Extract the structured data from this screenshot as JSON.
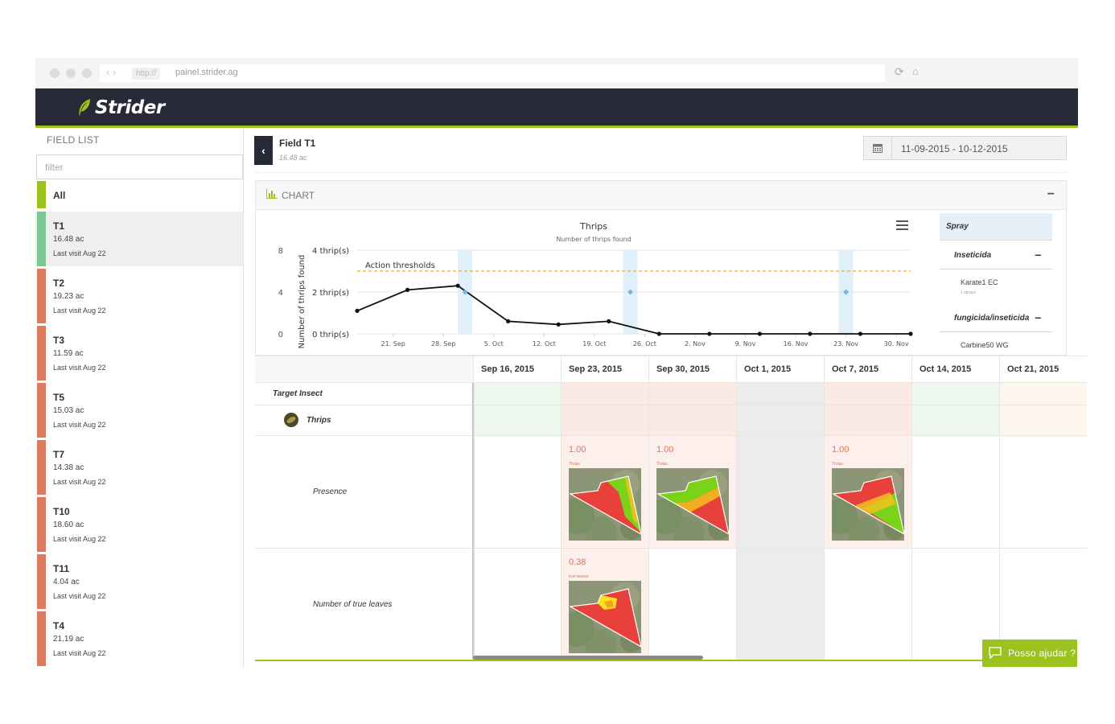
{
  "browser": {
    "protocol": "http://",
    "url": "painel.strider.ag",
    "nav_arrows": "‹ ›",
    "reload_icon": "reload-icon",
    "home_icon": "home-icon"
  },
  "app": {
    "name": "Strider",
    "logo_icon": "leaf-icon",
    "brand_color": "#9bc31f",
    "header_color": "#272a36"
  },
  "sidebar": {
    "title": "FIELD LIST",
    "filter_placeholder": "filter",
    "all_label": "All",
    "fields": [
      {
        "name": "T1",
        "acres": "16.48 ac",
        "last_visit": "Last visit Aug 22",
        "color": "#7dc698",
        "selected": true
      },
      {
        "name": "T2",
        "acres": "19.23 ac",
        "last_visit": "Last visit Aug 22",
        "color": "#de7a5e"
      },
      {
        "name": "T3",
        "acres": "11.59 ac",
        "last_visit": "Last visit Aug 22",
        "color": "#de7a5e"
      },
      {
        "name": "T5",
        "acres": "15.03 ac",
        "last_visit": "Last visit Aug 22",
        "color": "#de7a5e"
      },
      {
        "name": "T7",
        "acres": "14.38 ac",
        "last_visit": "Last visit Aug 22",
        "color": "#de7a5e"
      },
      {
        "name": "T10",
        "acres": "18.60 ac",
        "last_visit": "Last visit Aug 22",
        "color": "#de7a5e"
      },
      {
        "name": "T11",
        "acres": "4.04 ac",
        "last_visit": "Last visit Aug 22",
        "color": "#de7a5e"
      },
      {
        "name": "T4",
        "acres": "21.19 ac",
        "last_visit": "Last visit Aug 22",
        "color": "#de7a5e"
      }
    ]
  },
  "main": {
    "field_title": "Field T1",
    "field_acres": "16.48 ac",
    "date_range": "11-09-2015 - 10-12-2015",
    "chart_section_label": "CHART",
    "minimize_label": "−"
  },
  "chart_data": {
    "type": "line",
    "title": "Thrips",
    "subtitle": "Number of thrips found",
    "ylabel": "Number of thrips found",
    "y_ticks_right": [
      "4 thrip(s)",
      "2 thrip(s)",
      "0 thrip(s)"
    ],
    "y_ticks_left": [
      "8",
      "4",
      "0"
    ],
    "x_tick_labels": [
      "21. Sep",
      "28. Sep",
      "5. Oct",
      "12. Oct",
      "19. Oct",
      "26. Oct",
      "2. Nov",
      "9. Nov",
      "16. Nov",
      "23. Nov",
      "30. Nov"
    ],
    "series": [
      {
        "values": [
          {
            "x": "2015-09-16",
            "y": 1.1
          },
          {
            "x": "2015-09-23",
            "y": 2.1
          },
          {
            "x": "2015-09-30",
            "y": 2.3
          },
          {
            "x": "2015-10-07",
            "y": 0.6
          },
          {
            "x": "2015-10-14",
            "y": 0.45
          },
          {
            "x": "2015-10-21",
            "y": 0.6
          },
          {
            "x": "2015-10-28",
            "y": 0.0
          },
          {
            "x": "2015-11-04",
            "y": 0.0
          },
          {
            "x": "2015-11-11",
            "y": 0.0
          },
          {
            "x": "2015-11-18",
            "y": 0.0
          },
          {
            "x": "2015-11-25",
            "y": 0.0
          },
          {
            "x": "2015-12-02",
            "y": 0.0
          }
        ]
      }
    ],
    "threshold": {
      "label": "Action thresholds",
      "y": 3.0,
      "color": "#f5a623"
    },
    "spray_markers": [
      {
        "x": "2015-10-01",
        "y": 2.0
      },
      {
        "x": "2015-10-24",
        "y": 2.0
      },
      {
        "x": "2015-11-23",
        "y": 2.0
      }
    ],
    "ylim": [
      0,
      4
    ],
    "grid": true,
    "menu_icon": "hamburger-icon"
  },
  "spray": {
    "title": "Spray",
    "categories": [
      {
        "name": "Inseticida",
        "toggle": "−",
        "products": [
          {
            "name": "Karate1 EC",
            "count": "1 sprays"
          }
        ]
      },
      {
        "name": "fungicida/inseticida",
        "toggle": "−",
        "products": [
          {
            "name": "Carbine50 WG",
            "count": ""
          }
        ]
      }
    ]
  },
  "timeline": {
    "rows": {
      "target_insect": "Target Insect",
      "insect": "Thrips",
      "presence": "Presence",
      "true_leaves": "Number of true leaves"
    },
    "columns": [
      {
        "date": "Sep 16, 2015",
        "head_tint": "#eef8ef",
        "presence": null,
        "leaves": null
      },
      {
        "date": "Sep 23, 2015",
        "head_tint": "#fbe9e4",
        "presence": {
          "value": "1.00",
          "label": "Thrips",
          "map": 1
        },
        "leaves": {
          "value": "0.38",
          "label": "true leaves",
          "map": 2
        }
      },
      {
        "date": "Sep 30, 2015",
        "head_tint": "#fbe9e4",
        "presence": {
          "value": "1.00",
          "label": "Thrips",
          "map": 3
        },
        "leaves": null
      },
      {
        "date": "Oct 1, 2015",
        "head_tint": "#ececec",
        "presence": null,
        "leaves": null,
        "gray": true
      },
      {
        "date": "Oct 7, 2015",
        "head_tint": "#fbe9e4",
        "presence": {
          "value": "1.00",
          "label": "Thrips",
          "map": 4
        },
        "leaves": null
      },
      {
        "date": "Oct 14, 2015",
        "head_tint": "#eef8ef",
        "presence": null,
        "leaves": null
      },
      {
        "date": "Oct 21, 2015",
        "head_tint": "#fdf6ec",
        "presence": null,
        "leaves": null
      }
    ]
  },
  "help": {
    "label": "Posso ajudar ?",
    "icon": "chat-icon"
  }
}
